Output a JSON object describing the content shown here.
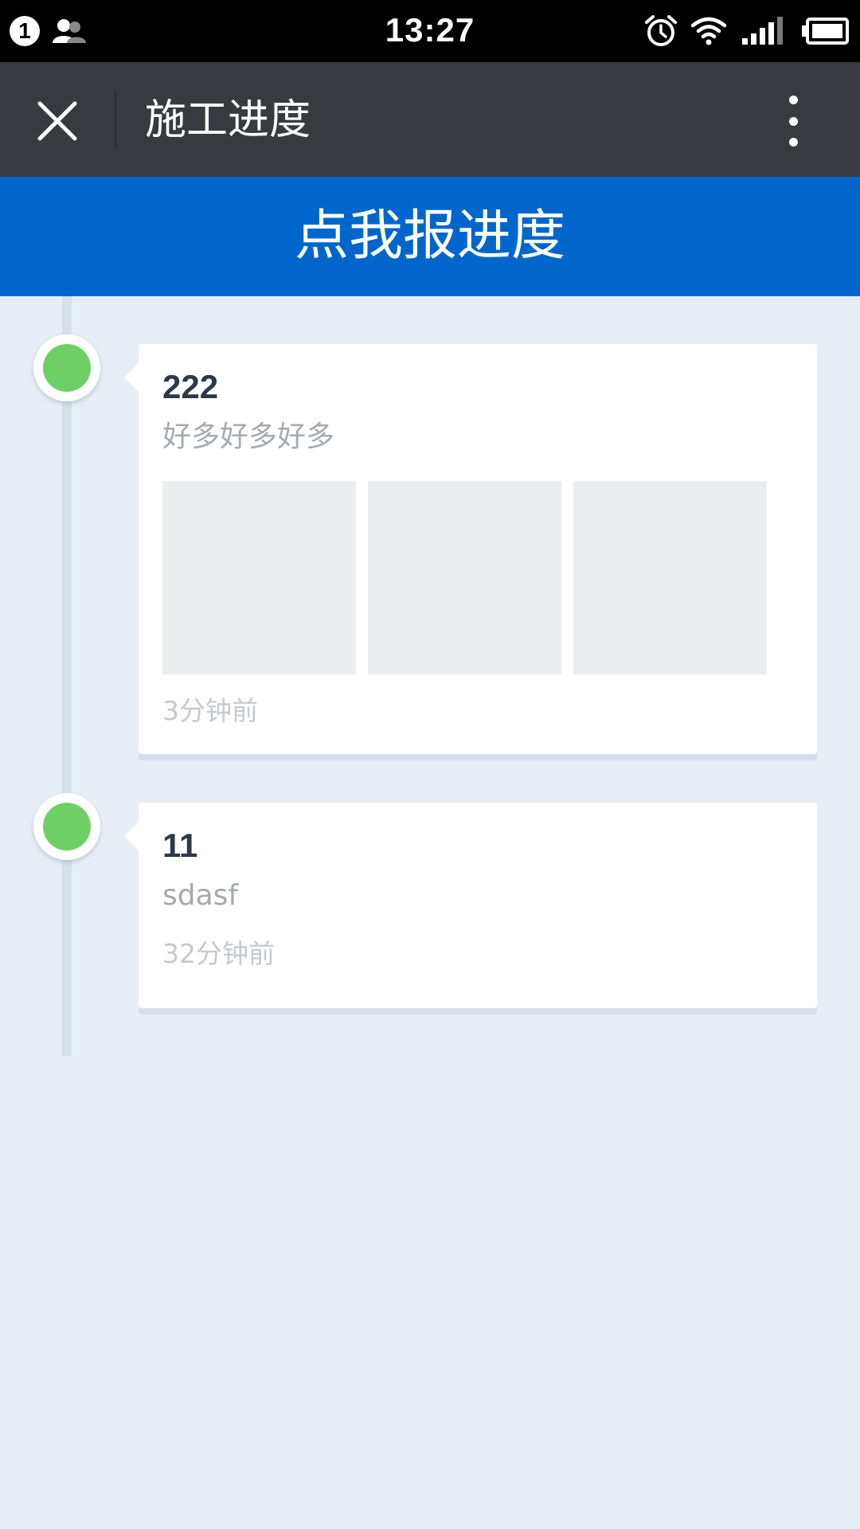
{
  "status_bar": {
    "notification_count": "1",
    "time": "13:27",
    "icons": [
      "contacts-icon",
      "alarm-icon",
      "wifi-icon",
      "signal-icon",
      "battery-icon"
    ]
  },
  "nav": {
    "title": "施工进度",
    "close_icon": "close-icon",
    "more_icon": "more-vertical-icon"
  },
  "action": {
    "report_label": "点我报进度",
    "color": "#0066cc"
  },
  "timeline": {
    "node_color": "#6fcf67",
    "items": [
      {
        "title": "222",
        "description": "好多好多好多",
        "photo_count": 3,
        "time": "3分钟前"
      },
      {
        "title": "11",
        "description": "sdasf",
        "photo_count": 0,
        "time": "32分钟前"
      }
    ]
  }
}
